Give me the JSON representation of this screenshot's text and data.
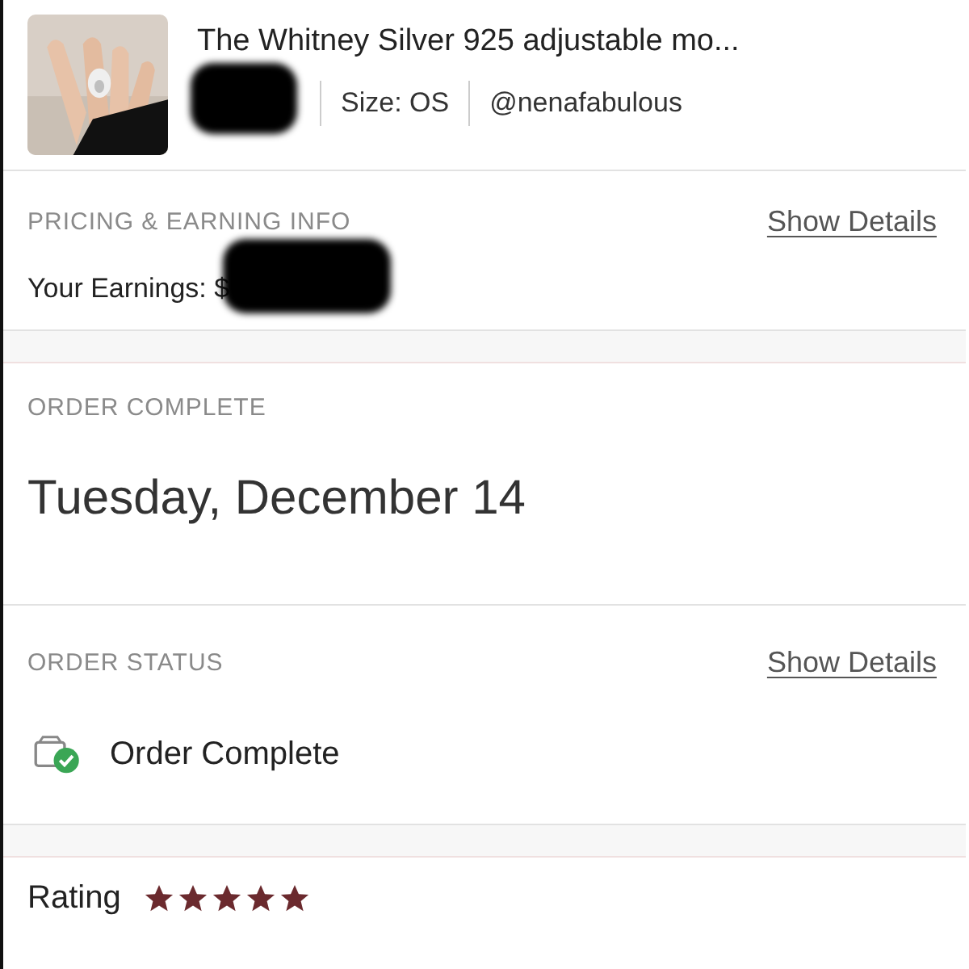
{
  "product": {
    "title": "The Whitney Silver 925 adjustable mo...",
    "size": "Size: OS",
    "seller": "@nenafabulous"
  },
  "pricing": {
    "label": "PRICING & EARNING INFO",
    "link": "Show Details",
    "earnings_label": "Your Earnings: $"
  },
  "completion": {
    "label": "ORDER COMPLETE",
    "date": "Tuesday, December 14"
  },
  "status": {
    "label": "ORDER STATUS",
    "link": "Show Details",
    "value": "Order Complete"
  },
  "rating": {
    "label": "Rating",
    "stars": 5
  }
}
